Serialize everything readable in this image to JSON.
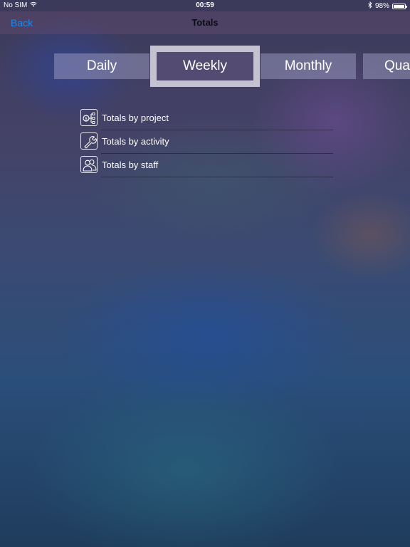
{
  "status_bar": {
    "carrier": "No SIM",
    "time": "00:59",
    "battery_percent": "98%",
    "battery_level": 0.98,
    "icons": [
      "wifi-icon",
      "bluetooth-icon",
      "battery-icon"
    ]
  },
  "nav_bar": {
    "back_label": "Back",
    "title": "Totals"
  },
  "tabs": [
    {
      "label": "Daily",
      "selected": false
    },
    {
      "label": "Weekly",
      "selected": true
    },
    {
      "label": "Monthly",
      "selected": false
    },
    {
      "label": "Quarterly",
      "selected": false
    }
  ],
  "totals_list": [
    {
      "label": "Totals by project",
      "icon": "project-hierarchy-icon"
    },
    {
      "label": "Totals by activity",
      "icon": "wrench-icon"
    },
    {
      "label": "Totals by staff",
      "icon": "staff-people-icon"
    }
  ],
  "colors": {
    "accent": "#1e88f0",
    "selected_tab_border": "#c4c2d0"
  }
}
